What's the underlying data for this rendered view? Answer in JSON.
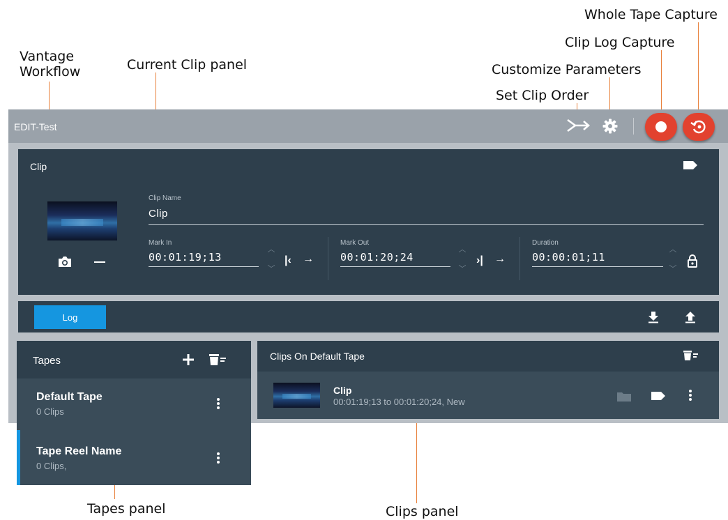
{
  "annotations": {
    "vantage_workflow": [
      "Vantage",
      "Workflow"
    ],
    "current_clip_panel": "Current Clip panel",
    "whole_tape_capture": "Whole Tape Capture",
    "clip_log_capture": "Clip Log Capture",
    "customize_parameters": "Customize Parameters",
    "set_clip_order": "Set Clip Order",
    "tapes_panel": "Tapes panel",
    "clips_panel": "Clips panel"
  },
  "app": {
    "title": "EDIT-Test",
    "accent_color": "#e2422f",
    "toolbar_icons": [
      "set-clip-order-icon",
      "customize-parameters-gear-icon",
      "clip-log-capture-record-icon",
      "whole-tape-capture-icon"
    ]
  },
  "clip_panel": {
    "header": "Clip",
    "clip_name_label": "Clip Name",
    "clip_name_value": "Clip",
    "mark_in_label": "Mark In",
    "mark_in_value": "00:01:19;13",
    "mark_out_label": "Mark Out",
    "mark_out_value": "00:01:20;24",
    "duration_label": "Duration",
    "duration_value": "00:00:01;11"
  },
  "log_bar": {
    "log_label": "Log",
    "accent_color": "#1596e0"
  },
  "tapes": {
    "header": "Tapes",
    "items": [
      {
        "name": "Default Tape",
        "count": "0 Clips"
      },
      {
        "name": "Tape Reel Name",
        "count": "0 Clips,"
      }
    ]
  },
  "clips": {
    "header": "Clips On Default Tape",
    "items": [
      {
        "name": "Clip",
        "detail": "00:01:19;13 to 00:01:20;24, New"
      }
    ]
  }
}
